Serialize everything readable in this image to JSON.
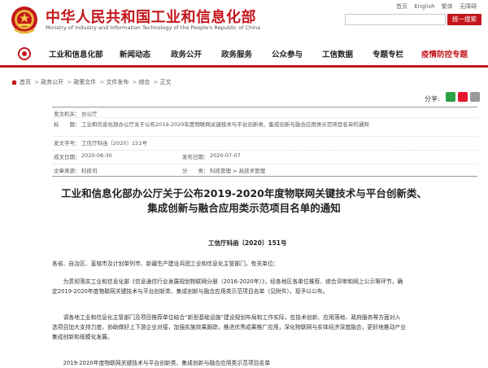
{
  "header": {
    "title": "中华人民共和国工业和信息化部",
    "subtitle": "Ministry of Industry and Information Technology of the People's Republic of China",
    "links": [
      "首页",
      "English",
      "繁体",
      "无障碍"
    ],
    "search_placeholder": "",
    "search_button": "统一搜索"
  },
  "nav": {
    "items": [
      "工业和信息化部",
      "新闻动态",
      "政务公开",
      "政务服务",
      "公众参与",
      "工信数据",
      "专题专栏",
      "疫情防控专题"
    ]
  },
  "breadcrumb": [
    "首页",
    "政务公开",
    "政策文件",
    "文件发布",
    "综合",
    "正文"
  ],
  "share": {
    "label": "分享:"
  },
  "meta": {
    "issuer_label": "发文机关：",
    "issuer": "办公厅",
    "subject_label": "标　　题：",
    "subject": "工业和信息化部办公厅关于公布2019-2020年度物联网关键技术与平台创新类、集成创新与融合应用类示范项目名单的通知",
    "docno_label": "发文字号：",
    "docno": "工信厅科函〔2020〕151号",
    "written_label": "成文日期：",
    "written": "2020-06-30",
    "published_label": "发布日期：",
    "published": "2020-07-07",
    "unit_label": "文章来源：",
    "unit": "科技司",
    "category_label": "分　　类：",
    "category": "科技管理 > 高技术管理"
  },
  "article": {
    "title": "工业和信息化部办公厅关于公布2019-2020年度物联网关键技术与平台创新类、集成创新与融合应用类示范项目名单的通知",
    "doc_no": "工信厅科函〔2020〕151号",
    "salutation": "各省、自治区、直辖市及计划单列市、新疆生产建设兵团工业和信息化主管部门，有关单位：",
    "p1": [
      "　　为贯彻落实工业和信息化部《信息通信行业发展规划物联网分册（2016-2020年）》，经各地区各单位推荐、综合评审和网上公示等环节，确",
      "定2019-2020年度物联网关键技术与平台创新类、集成创新与融合应用类示范项目名单（见附件），现予以公布。"
    ],
    "p2": [
      "　　请各地工业和信息化主管部门及项目推荐单位结合“新型基础设施”建设规划布局和工作实际，在技术创新、应用落地、政府服务等方面对入",
      "选项目加大支持力度，协助做好上下游企业对接，加强实施效果跟踪，推进优秀成果推广应用，深化物联网与实体经济深度融合，更好地推动产业",
      "集成创新和规模化发展。"
    ],
    "p3": "　　2019-2020年度物联网关键技术与平台创新类、集成创新与融合应用类示范项目名单"
  },
  "colors": {
    "brand_red": "#c4161c"
  }
}
